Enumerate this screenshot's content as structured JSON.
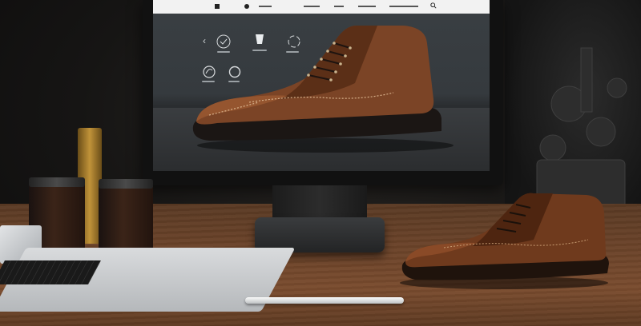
{
  "scene": {
    "description_tags": [
      "monitor-ecommerce-product-page",
      "brown-brogue-boot",
      "wooden-desk",
      "laptop",
      "pen",
      "glass-jars"
    ]
  },
  "screen": {
    "navbar": {
      "items": [
        "",
        "",
        "",
        "",
        ""
      ]
    },
    "feature_icons": [
      "shield-check-icon",
      "cup-icon",
      "recycle-icon",
      "leaf-icon",
      "circle-icon"
    ]
  },
  "colors": {
    "leather": "#7b4426",
    "leather_dark": "#3e1d0d",
    "sole": "#1b1614",
    "desk": "#6b4329",
    "screen_bg": "#383d41"
  }
}
